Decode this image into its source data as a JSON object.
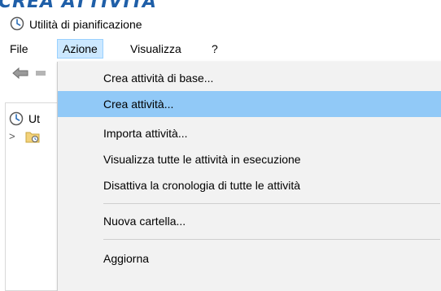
{
  "banner": {
    "text": "CREA ATTIVITÀ"
  },
  "window": {
    "title": "Utilità di pianificazione",
    "icon": "clock-icon"
  },
  "menubar": {
    "items": [
      {
        "label": "File"
      },
      {
        "label": "Azione",
        "active": true
      },
      {
        "label": "Visualizza"
      },
      {
        "label": "?"
      }
    ]
  },
  "toolbar": {
    "icons": [
      "back-arrow-icon",
      "forward-arrow-icon"
    ]
  },
  "tree": {
    "items": [
      {
        "label": "Ut",
        "icon": "clock-icon"
      },
      {
        "label": "",
        "icon": "folder-clock-icon"
      }
    ]
  },
  "dropdown": {
    "items": [
      {
        "label": "Crea attività di base..."
      },
      {
        "label": "Crea attività...",
        "highlighted": true
      },
      {
        "label": "Importa attività..."
      },
      {
        "label": "Visualizza tutte le attività in esecuzione"
      },
      {
        "label": "Disattiva la cronologia di tutte le attività"
      },
      {
        "label": "Nuova cartella..."
      },
      {
        "label": "Aggiorna"
      }
    ]
  },
  "colors": {
    "highlight": "#91c9f7",
    "menu_active": "#cce8ff",
    "menu_bg": "#f2f2f2",
    "banner": "#1f5fa8"
  }
}
